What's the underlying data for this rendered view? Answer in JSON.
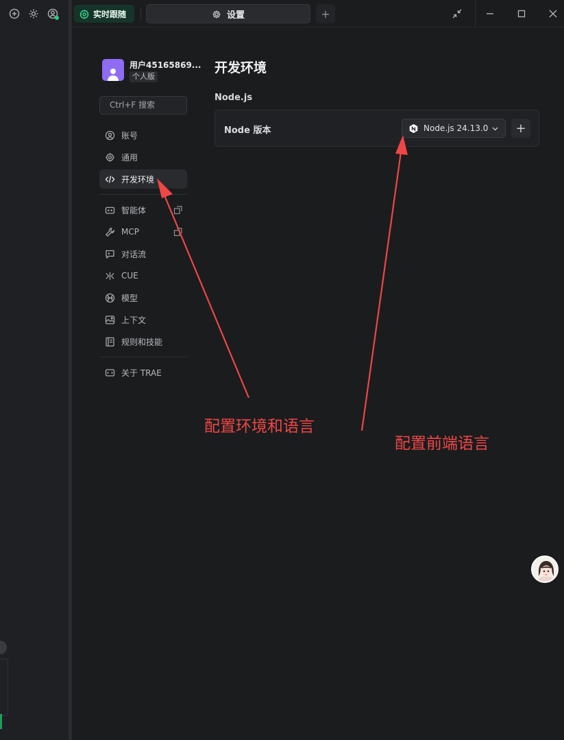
{
  "left_strip": {
    "icons": [
      "add-chat-icon",
      "gear-icon",
      "account-icon"
    ],
    "status_color": "#1fd27a"
  },
  "titlebar": {
    "live_tab_label": "实时跟随",
    "settings_tab_label": "设置",
    "add_tab_symbol": "+",
    "accent_live": "#16352a"
  },
  "sidebar": {
    "username": "用户45165869...",
    "plan": "个人版",
    "search_placeholder": "Ctrl+F 搜索",
    "groups": [
      {
        "items": [
          {
            "label": "账号",
            "icon": "account-icon"
          },
          {
            "label": "通用",
            "icon": "gear-icon"
          },
          {
            "label": "开发环境",
            "icon": "code-icon",
            "active": true
          }
        ]
      },
      {
        "items": [
          {
            "label": "智能体",
            "icon": "agent-icon",
            "external": true
          },
          {
            "label": "MCP",
            "icon": "wrench-icon",
            "external": true
          },
          {
            "label": "对话流",
            "icon": "chat-flow-icon"
          },
          {
            "label": "CUE",
            "icon": "cue-icon"
          },
          {
            "label": "模型",
            "icon": "model-icon"
          },
          {
            "label": "上下文",
            "icon": "context-icon"
          },
          {
            "label": "规则和技能",
            "icon": "rules-icon"
          }
        ]
      },
      {
        "items": [
          {
            "label": "关于 TRAE",
            "icon": "about-icon"
          }
        ]
      }
    ]
  },
  "main": {
    "title": "开发环境",
    "section": "Node.js",
    "card_label": "Node 版本",
    "selected_version": "Node.js 24.13.0",
    "add_symbol": "+"
  },
  "annotations": {
    "left_note": "配置环境和语言",
    "right_note": "配置前端语言",
    "color": "#ef4646"
  }
}
